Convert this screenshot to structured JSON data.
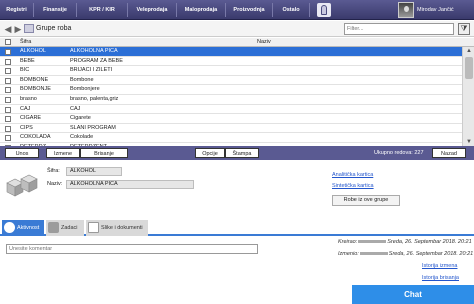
{
  "menu": [
    "Registri",
    "Finansije",
    "KPR / KIR",
    "Veleprodaja",
    "Maloprodaja",
    "Proizvodnja",
    "Ostalo"
  ],
  "user": {
    "name": "Mirodav Jančić"
  },
  "toolbar": {
    "title": "Grupe roba",
    "filter_placeholder": "Filter..."
  },
  "grid": {
    "columns": [
      "Šifra",
      "Naziv"
    ],
    "rows": [
      {
        "code": "ALKOHOL",
        "name": "ALKOHOLNA PICA",
        "selected": true
      },
      {
        "code": "BEBE",
        "name": "PROGRAM ZA BEBE"
      },
      {
        "code": "BIC",
        "name": "BRIJACI I ZILETI"
      },
      {
        "code": "BOMBONE",
        "name": "Bombone"
      },
      {
        "code": "BOMBONJE",
        "name": "Bombonjere"
      },
      {
        "code": "brasno",
        "name": "brasno, palenta,griz"
      },
      {
        "code": "CAJ",
        "name": "CAJ"
      },
      {
        "code": "CIGARE",
        "name": "Cigarete"
      },
      {
        "code": "CIPS",
        "name": "SLANI PROGRAM"
      },
      {
        "code": "COKOLADA",
        "name": "Cokolade"
      },
      {
        "code": "DETERDZ",
        "name": "DETERDZENT"
      }
    ]
  },
  "actions": {
    "unos": "Unos",
    "izmene": "Izmene",
    "brisanje": "Brisanje",
    "opcije": "Opcije",
    "stampa": "Štampa",
    "count": "Ukupno redova: 227",
    "nazad": "Nazad"
  },
  "detail": {
    "sifra_label": "Šifra:",
    "sifra_value": "ALKOHOL",
    "naziv_label": "Naziv:",
    "naziv_value": "ALKOHOLNA PICA",
    "analiticka": "Analitička kartica",
    "sinteticka": "Sintetička kartica",
    "robe_button": "Robe iz ove grupe"
  },
  "tabs": [
    "Aktivnost",
    "Zadaci",
    "Slike i dokumenti"
  ],
  "activity": {
    "comment_placeholder": "Unesite komentar",
    "kreirao_label": "Kreirao:",
    "kreirao_date": "Sreda, 26. Septembar 2018. 20:21",
    "izmenio_label": "Izmenio:",
    "izmenio_date": "Sreda, 26. Septembar 2018. 20:21",
    "istorija_izmena": "Istorija izmena",
    "istorija_brisanja": "Istorija brisanja",
    "chat": "Chat"
  },
  "colors": {
    "header": "#3a3a6c",
    "selected_row": "#2c6fd6",
    "accent": "#3a7bd5",
    "chat": "#2e8ee8"
  }
}
